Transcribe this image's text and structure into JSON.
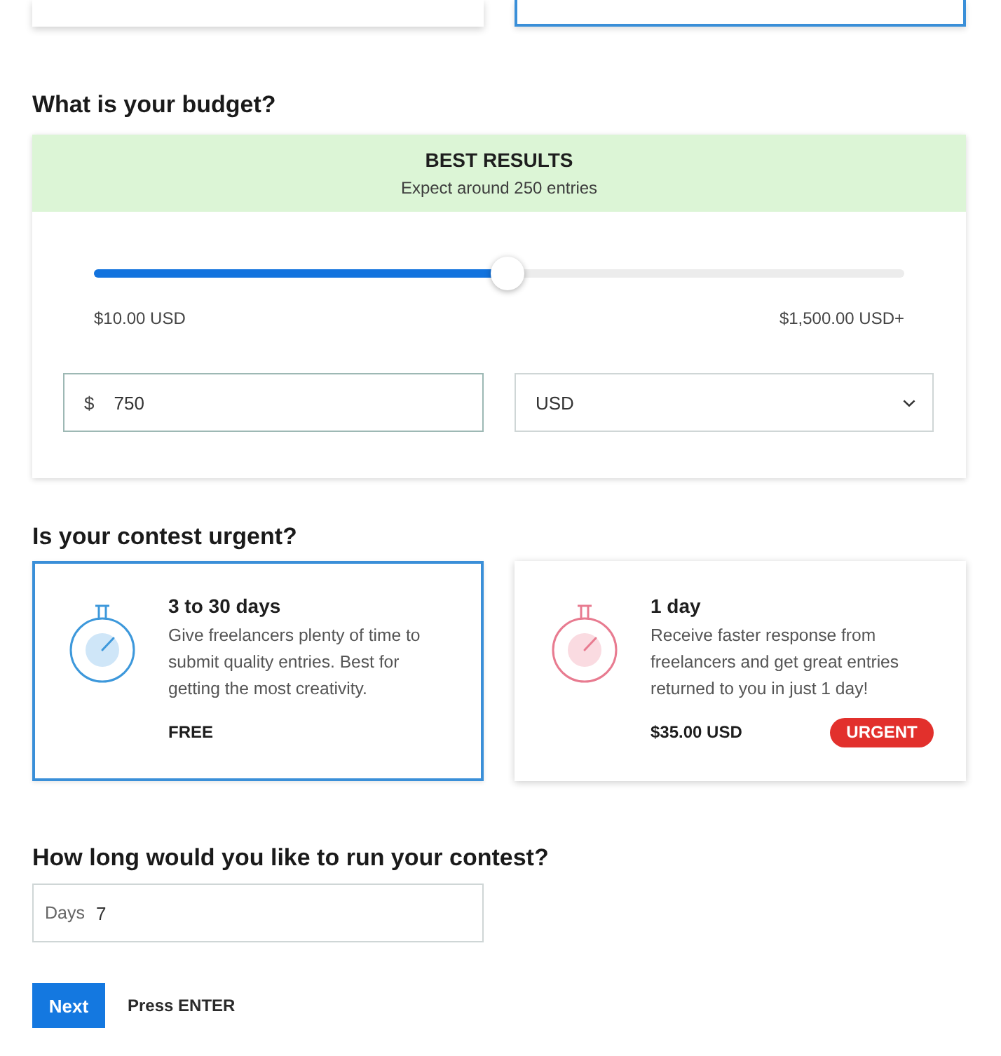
{
  "previous_cards": [
    {
      "selected": false
    },
    {
      "selected": true
    }
  ],
  "budget": {
    "heading": "What is your budget?",
    "banner": {
      "title": "BEST RESULTS",
      "subtitle": "Expect around 250 entries"
    },
    "slider": {
      "level": 0.51,
      "min_label": "$10.00 USD",
      "max_label": "$1,500.00 USD+"
    },
    "amount": {
      "prefix": "$",
      "value": "750"
    },
    "currency": {
      "value": "USD"
    }
  },
  "urgency": {
    "heading": "Is your contest urgent?",
    "options": [
      {
        "kind": "standard",
        "selected": true,
        "title": "3 to 30 days",
        "description": "Give freelancers plenty of time to submit quality entries. Best for getting the most creativity.",
        "price": "FREE"
      },
      {
        "kind": "urgent",
        "selected": false,
        "title": "1 day",
        "description": "Receive faster response from freelancers and get great entries returned to you in just 1 day!",
        "price": "$35.00 USD",
        "badge": "URGENT"
      }
    ]
  },
  "duration": {
    "heading": "How long would you like to run your contest?",
    "field": {
      "label": "Days",
      "value": "7"
    }
  },
  "actions": {
    "button": "Next",
    "hint": "Press ENTER"
  }
}
